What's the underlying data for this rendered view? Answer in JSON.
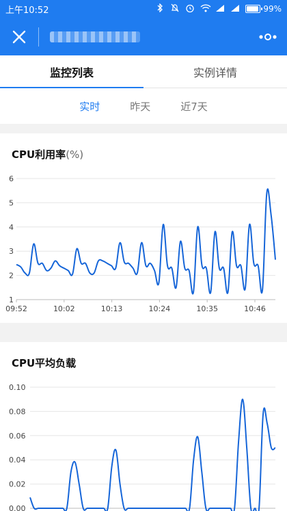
{
  "status_bar": {
    "time": "上午10:52",
    "battery": "99%",
    "battery_level": 0.99,
    "icons": [
      "bluetooth-icon",
      "mute-icon",
      "alarm-icon",
      "wifi-icon",
      "signal-icon",
      "signal-icon",
      "battery-icon"
    ]
  },
  "app_bar": {
    "close_icon": "close-icon",
    "more_icon": "more-dots-icon"
  },
  "tabs": [
    {
      "label": "监控列表",
      "active": true
    },
    {
      "label": "实例详情",
      "active": false
    }
  ],
  "periods": [
    {
      "label": "实时",
      "active": true
    },
    {
      "label": "昨天",
      "active": false
    },
    {
      "label": "近7天",
      "active": false
    }
  ],
  "cards": [
    {
      "title": "CPU利用率",
      "unit": "(%)"
    },
    {
      "title": "CPU平均负载",
      "unit": ""
    }
  ],
  "colors": {
    "accent": "#1f7cf0",
    "line": "#1565d8"
  },
  "chart_data": [
    {
      "type": "line",
      "title": "CPU利用率",
      "ylabel": "(%)",
      "ylim": [
        1,
        6
      ],
      "y_ticks": [
        "1",
        "2",
        "3",
        "4",
        "5",
        "6"
      ],
      "x_ticks": [
        "09:52",
        "10:02",
        "10:13",
        "10:24",
        "10:35",
        "10:46"
      ],
      "grid": true,
      "x_range": [
        0,
        60
      ],
      "x": [
        0,
        1,
        2,
        3,
        4,
        5,
        6,
        7,
        8,
        9,
        10,
        11,
        12,
        13,
        14,
        15,
        16,
        17,
        18,
        19,
        20,
        21,
        22,
        23,
        24,
        25,
        26,
        27,
        28,
        29,
        30,
        31,
        32,
        33,
        34,
        35,
        36,
        37,
        38,
        39,
        40,
        41,
        42,
        43,
        44,
        45,
        46,
        47,
        48,
        49,
        50,
        51,
        52,
        53,
        54,
        55,
        56,
        57,
        58,
        59,
        60
      ],
      "series": [
        {
          "values": [
            2.45,
            2.35,
            2.1,
            2.1,
            3.3,
            2.5,
            2.5,
            2.2,
            2.3,
            2.6,
            2.4,
            2.3,
            2.2,
            2.05,
            3.1,
            2.5,
            2.5,
            2.1,
            2.1,
            2.6,
            2.6,
            2.5,
            2.4,
            2.3,
            3.35,
            2.55,
            2.5,
            2.3,
            2.1,
            3.35,
            2.4,
            2.5,
            2.2,
            1.7,
            4.1,
            2.4,
            2.3,
            1.5,
            3.4,
            2.3,
            2.2,
            1.3,
            4.0,
            2.4,
            2.3,
            1.3,
            3.8,
            2.3,
            2.3,
            1.3,
            3.8,
            2.4,
            2.4,
            1.45,
            4.1,
            2.5,
            2.4,
            1.4,
            5.4,
            4.5,
            2.65
          ]
        }
      ]
    },
    {
      "type": "line",
      "title": "CPU平均负载",
      "ylim": [
        0,
        0.1
      ],
      "y_ticks": [
        "0.00",
        "0.02",
        "0.04",
        "0.06",
        "0.08",
        "0.10"
      ],
      "grid": true,
      "x_range": [
        0,
        60
      ],
      "x": [
        0,
        1,
        2,
        3,
        4,
        5,
        6,
        7,
        8,
        9,
        10,
        11,
        12,
        13,
        14,
        15,
        16,
        17,
        18,
        19,
        20,
        21,
        22,
        23,
        24,
        25,
        26,
        27,
        28,
        29,
        30,
        31,
        32,
        33,
        34,
        35,
        36,
        37,
        38,
        39,
        40,
        41,
        42,
        43,
        44,
        45,
        46,
        47,
        48,
        49,
        50,
        51,
        52,
        53,
        54,
        55,
        56,
        57,
        58,
        59,
        60
      ],
      "series": [
        {
          "values": [
            0.009,
            0,
            0,
            0,
            0,
            0,
            0,
            0,
            0,
            0,
            0.03,
            0.038,
            0.02,
            0,
            0,
            0,
            0,
            0,
            0,
            0,
            0.035,
            0.048,
            0.02,
            0,
            0,
            0,
            0,
            0,
            0,
            0,
            0,
            0,
            0,
            0,
            0,
            0,
            0,
            0,
            0,
            0,
            0.04,
            0.059,
            0.03,
            0,
            0,
            0,
            0,
            0,
            0,
            0,
            0,
            0.055,
            0.09,
            0.05,
            0.0,
            0,
            0,
            0.078,
            0.07,
            0.05,
            0.05
          ]
        }
      ]
    }
  ]
}
